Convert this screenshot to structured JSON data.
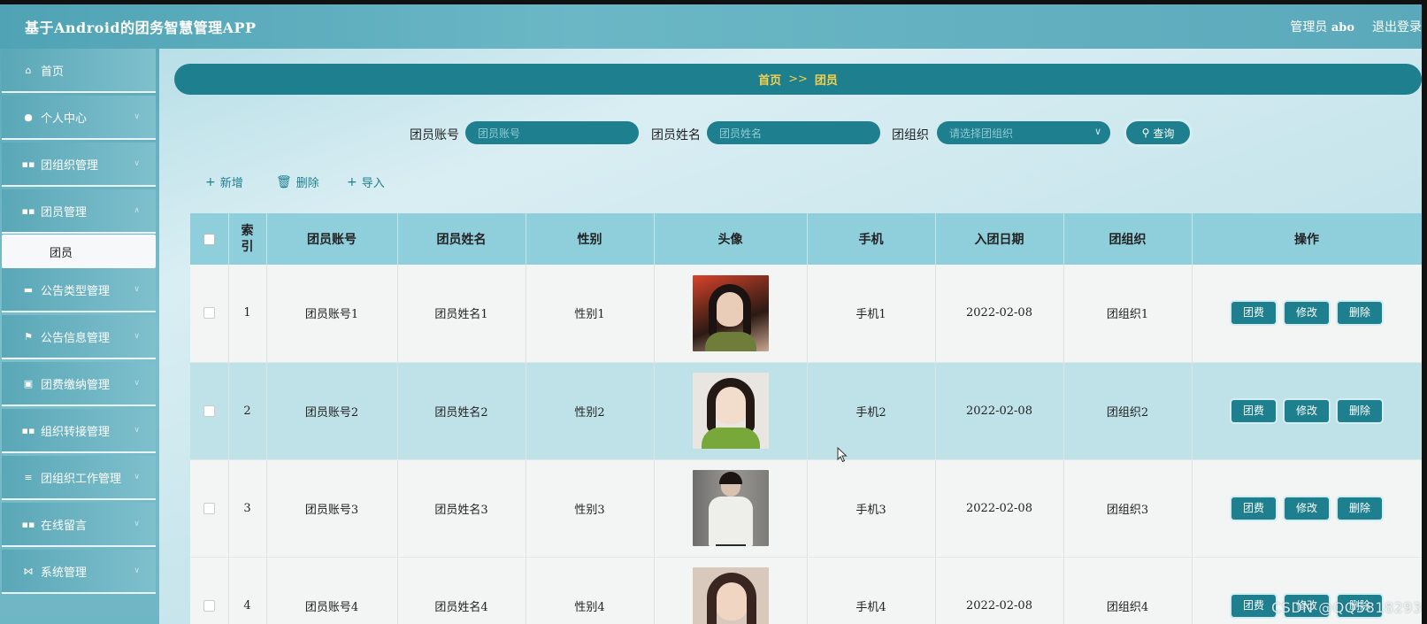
{
  "header": {
    "app_title": "基于Android的团务智慧管理APP",
    "user_role": "管理员",
    "user_name": "abo",
    "logout_label": "退出登录"
  },
  "sidebar": {
    "items": [
      {
        "label": "首页",
        "icon": "home-icon",
        "has_children": false
      },
      {
        "label": "个人中心",
        "icon": "person-icon",
        "has_children": true
      },
      {
        "label": "团组织管理",
        "icon": "grid-icon",
        "has_children": true
      },
      {
        "label": "团员管理",
        "icon": "grid-icon",
        "has_children": true
      },
      {
        "label": "公告类型管理",
        "icon": "monitor-icon",
        "has_children": true
      },
      {
        "label": "公告信息管理",
        "icon": "flag-icon",
        "has_children": true
      },
      {
        "label": "团费缴纳管理",
        "icon": "chart-icon",
        "has_children": true
      },
      {
        "label": "组织转接管理",
        "icon": "grid-icon",
        "has_children": true
      },
      {
        "label": "团组织工作管理",
        "icon": "list-icon",
        "has_children": true
      },
      {
        "label": "在线留言",
        "icon": "grid-icon",
        "has_children": true
      },
      {
        "label": "系统管理",
        "icon": "bowtie-icon",
        "has_children": true
      }
    ],
    "active_sub": "团员"
  },
  "breadcrumb": {
    "home": "首页",
    "separator": ">>",
    "current": "团员"
  },
  "search": {
    "account_label": "团员账号",
    "account_placeholder": "团员账号",
    "name_label": "团员姓名",
    "name_placeholder": "团员姓名",
    "org_label": "团组织",
    "org_placeholder": "请选择团组织",
    "query_label": "查询"
  },
  "toolbar": {
    "add_label": "新增",
    "delete_label": "删除",
    "import_label": "导入"
  },
  "table": {
    "columns": {
      "index": "索引",
      "account": "团员账号",
      "name": "团员姓名",
      "gender": "性别",
      "avatar": "头像",
      "phone": "手机",
      "join_date": "入团日期",
      "org": "团组织",
      "actions": "操作"
    },
    "rows": [
      {
        "index": "1",
        "account": "团员账号1",
        "name": "团员姓名1",
        "gender": "性别1",
        "phone": "手机1",
        "join_date": "2022-02-08",
        "org": "团组织1"
      },
      {
        "index": "2",
        "account": "团员账号2",
        "name": "团员姓名2",
        "gender": "性别2",
        "phone": "手机2",
        "join_date": "2022-02-08",
        "org": "团组织2"
      },
      {
        "index": "3",
        "account": "团员账号3",
        "name": "团员姓名3",
        "gender": "性别3",
        "phone": "手机3",
        "join_date": "2022-02-08",
        "org": "团组织3"
      },
      {
        "index": "4",
        "account": "团员账号4",
        "name": "团员姓名4",
        "gender": "性别4",
        "phone": "手机4",
        "join_date": "2022-02-08",
        "org": "团组织4"
      }
    ],
    "action_labels": {
      "fee": "团费",
      "edit": "修改",
      "delete": "删除"
    }
  },
  "watermark": "CSDN @QQ5818293",
  "colors": {
    "primary": "#1e7f8f",
    "header_bg": "#5aa9ba",
    "table_header": "#8fcfdb",
    "row_alt": "#bfe2e8",
    "breadcrumb_text": "#f5d24a"
  }
}
